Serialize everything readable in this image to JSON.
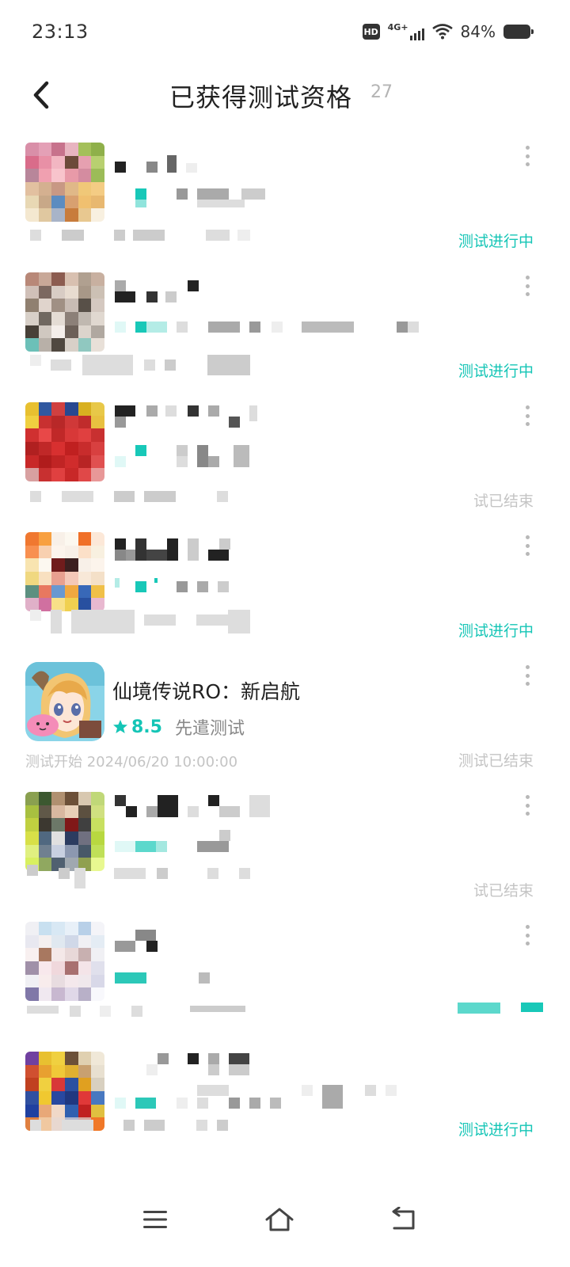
{
  "status_bar": {
    "time": "23:13",
    "hd_label": "HD",
    "network": "4G+",
    "battery": "84%"
  },
  "header": {
    "title": "已获得测试资格",
    "count": "27"
  },
  "items": [
    {
      "name": "",
      "rating": "",
      "type": "",
      "start_time": "",
      "status": "测试进行中",
      "status_kind": "active"
    },
    {
      "name": "",
      "rating": "",
      "type": "",
      "start_time": "",
      "status": "测试进行中",
      "status_kind": "active"
    },
    {
      "name": "",
      "rating": "",
      "type": "",
      "start_time": "",
      "status": "试已结束",
      "status_kind": "ended"
    },
    {
      "name": "",
      "rating": "",
      "type": "",
      "start_time": "",
      "status": "测试进行中",
      "status_kind": "active"
    },
    {
      "name": "仙境传说RO：新启航",
      "rating": "8.5",
      "type": "先遣测试",
      "start_time": "测试开始 2024/06/20 10:00:00",
      "status": "测试已结束",
      "status_kind": "ended"
    },
    {
      "name": "",
      "rating": "",
      "type": "",
      "start_time": "",
      "status": "试已结束",
      "status_kind": "ended"
    },
    {
      "name": "",
      "rating": "",
      "type": "",
      "start_time": "",
      "status": "",
      "status_kind": "active"
    },
    {
      "name": "",
      "rating": "",
      "type": "",
      "start_time": "",
      "status": "测试进行中",
      "status_kind": "active"
    }
  ],
  "colors": {
    "accent": "#15c5b6",
    "muted": "#c4c4c4",
    "title": "#222222"
  },
  "icons": {
    "back": "chevron-left-icon",
    "more": "more-vertical-icon",
    "star": "star-icon",
    "nav_menu": "menu-icon",
    "nav_home": "home-icon",
    "nav_back": "return-icon"
  }
}
